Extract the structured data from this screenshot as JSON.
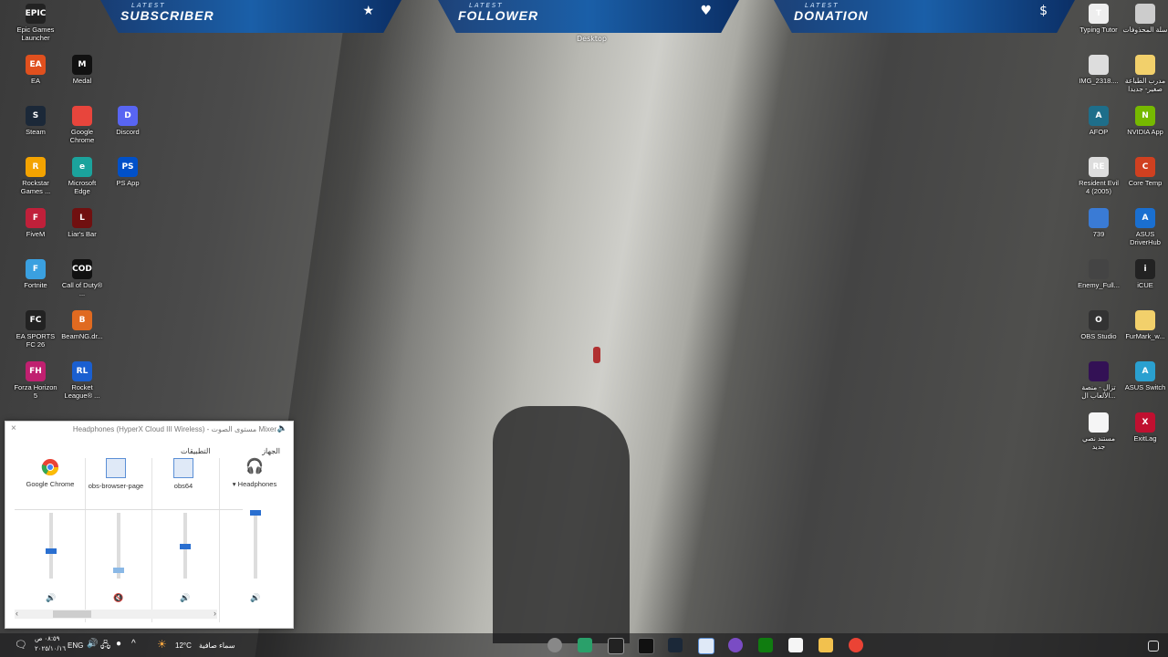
{
  "overlay": {
    "latest_word": "LATEST",
    "banners": [
      {
        "title": "SUBSCRIBER",
        "icon": "star-icon"
      },
      {
        "title": "FOLLOWER",
        "icon": "heart-icon"
      },
      {
        "title": "DONATION",
        "icon": "dollar-icon"
      }
    ],
    "desktop_label": "Desktop"
  },
  "desktop_icons_left": [
    {
      "label": "Epic Games Launcher",
      "abbr": "EPIC",
      "color": "#222"
    },
    {
      "label": "EA",
      "abbr": "EA",
      "color": "#e0501e"
    },
    {
      "label": "Medal",
      "abbr": "M",
      "color": "#111"
    },
    {
      "label": "Steam",
      "abbr": "S",
      "color": "#1b2838"
    },
    {
      "label": "Google Chrome",
      "abbr": "",
      "color": "#e8453c"
    },
    {
      "label": "Discord",
      "abbr": "D",
      "color": "#5865f2"
    },
    {
      "label": "Rockstar Games ...",
      "abbr": "R",
      "color": "#f4a300"
    },
    {
      "label": "Microsoft Edge",
      "abbr": "e",
      "color": "#1ba39c"
    },
    {
      "label": "PS App",
      "abbr": "PS",
      "color": "#0050c8"
    },
    {
      "label": "FiveM",
      "abbr": "F",
      "color": "#c0203a"
    },
    {
      "label": "Liar's Bar",
      "abbr": "L",
      "color": "#701010"
    },
    {
      "label": "Fortnite",
      "abbr": "F",
      "color": "#3aa0e0"
    },
    {
      "label": "Call of Duty® ...",
      "abbr": "COD",
      "color": "#111"
    },
    {
      "label": "EA SPORTS FC 26",
      "abbr": "FC",
      "color": "#222"
    },
    {
      "label": "BeamNG.dr...",
      "abbr": "B",
      "color": "#e06a20"
    },
    {
      "label": "Forza Horizon 5",
      "abbr": "FH",
      "color": "#c02070"
    },
    {
      "label": "Rocket League® ...",
      "abbr": "RL",
      "color": "#1a5fd0"
    }
  ],
  "desktop_icons_right": [
    {
      "label": "Typing Tutor",
      "abbr": "T",
      "color": "#eee"
    },
    {
      "label": "سلة المحذوفات",
      "abbr": "",
      "color": "#ccc"
    },
    {
      "label": "IMG_2318....",
      "abbr": "",
      "color": "#ddd"
    },
    {
      "label": "مدرب الطباعة صغير- جديدا",
      "abbr": "",
      "color": "#f2d06b"
    },
    {
      "label": "AFOP",
      "abbr": "A",
      "color": "#1e6e8a"
    },
    {
      "label": "NVIDIA App",
      "abbr": "N",
      "color": "#76b900"
    },
    {
      "label": "Resident Evil 4 (2005)",
      "abbr": "RE",
      "color": "#ddd"
    },
    {
      "label": "Core Temp",
      "abbr": "C",
      "color": "#d04020"
    },
    {
      "label": "739",
      "abbr": "",
      "color": "#3a7bd5"
    },
    {
      "label": "ASUS DriverHub",
      "abbr": "A",
      "color": "#1a6fd0"
    },
    {
      "label": "Enemy_Full...",
      "abbr": "",
      "color": "#444"
    },
    {
      "label": "iCUE",
      "abbr": "i",
      "color": "#222"
    },
    {
      "label": "OBS Studio",
      "abbr": "O",
      "color": "#333"
    },
    {
      "label": "FurMark_w...",
      "abbr": "",
      "color": "#f2d06b"
    },
    {
      "label": "تزال - منصة الألعاب ال...",
      "abbr": "",
      "color": "#331155"
    },
    {
      "label": "ASUS Switch",
      "abbr": "A",
      "color": "#2aa0d0"
    },
    {
      "label": "مستند نصي جديد",
      "abbr": "",
      "color": "#f5f5f5"
    },
    {
      "label": "ExitLag",
      "abbr": "X",
      "color": "#c01030"
    }
  ],
  "mixer": {
    "title": "Headphones (HyperX Cloud III Wireless) - مستوى الصوت Mixer",
    "device_section": "الجهاز",
    "apps_section": "التطبيقات",
    "device_name": "Headphones",
    "apps": [
      "Google Chrome",
      "obs-browser-page",
      "obs64"
    ],
    "levels": {
      "device": 1.0,
      "chrome": 0.42,
      "obs_browser": 0.12,
      "obs64": 0.48
    },
    "muted": {
      "obs_browser": true
    }
  },
  "taskbar": {
    "language": "ENG",
    "time": "٠٨:٥٩ ص",
    "date": "٢٠٢٥/١٠/١٦",
    "weather_temp": "12°C",
    "weather_desc": "سماء صافية"
  }
}
